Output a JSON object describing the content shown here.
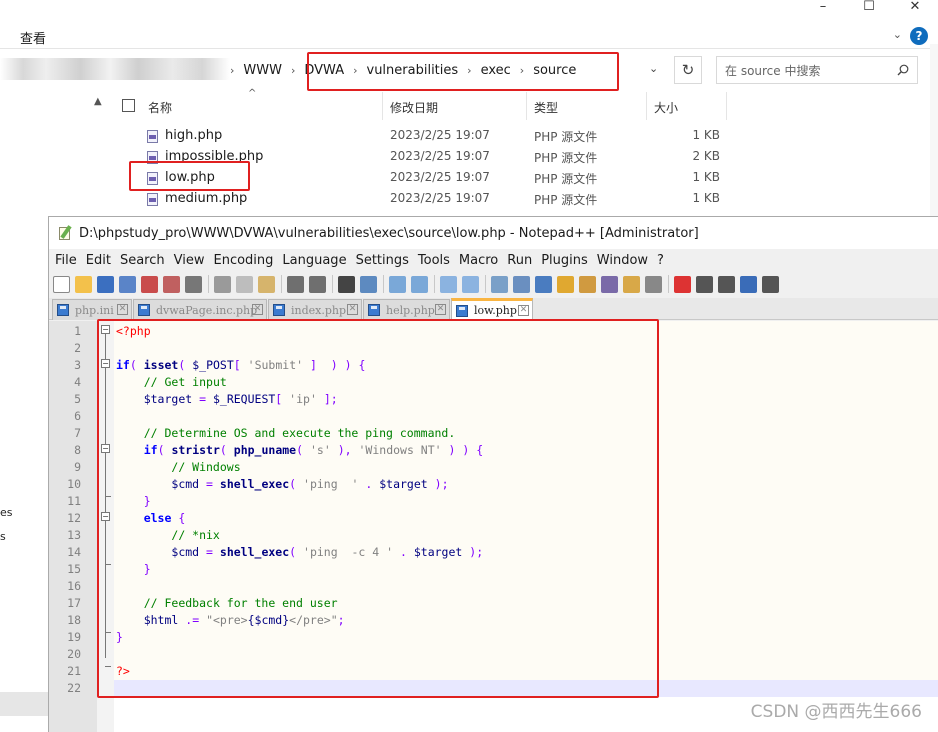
{
  "explorer": {
    "window_controls": [
      "–",
      "☐",
      "✕"
    ],
    "ribbon_label": "查看",
    "help_label": "?",
    "breadcrumb": [
      "WWW",
      "DVWA",
      "vulnerabilities",
      "exec",
      "source"
    ],
    "search_placeholder": "在 source 中搜索",
    "columns": {
      "name": "名称",
      "modified": "修改日期",
      "type": "类型",
      "size": "大小"
    },
    "files": [
      {
        "name": "high.php",
        "modified": "2023/2/25 19:07",
        "type": "PHP 源文件",
        "size": "1 KB"
      },
      {
        "name": "impossible.php",
        "modified": "2023/2/25 19:07",
        "type": "PHP 源文件",
        "size": "2 KB"
      },
      {
        "name": "low.php",
        "modified": "2023/2/25 19:07",
        "type": "PHP 源文件",
        "size": "1 KB"
      },
      {
        "name": "medium.php",
        "modified": "2023/2/25 19:07",
        "type": "PHP 源文件",
        "size": "1 KB"
      }
    ],
    "side_fragments": [
      "es",
      "s"
    ]
  },
  "npp": {
    "title": "D:\\phpstudy_pro\\WWW\\DVWA\\vulnerabilities\\exec\\source\\low.php - Notepad++ [Administrator]",
    "menu": [
      "File",
      "Edit",
      "Search",
      "View",
      "Encoding",
      "Language",
      "Settings",
      "Tools",
      "Macro",
      "Run",
      "Plugins",
      "Window",
      "?"
    ],
    "tabs": [
      {
        "label": "php.ini",
        "active": false
      },
      {
        "label": "dvwaPage.inc.php",
        "active": false
      },
      {
        "label": "index.php",
        "active": false
      },
      {
        "label": "help.php",
        "active": false
      },
      {
        "label": "low.php",
        "active": true
      }
    ],
    "line_numbers": [
      "1",
      "2",
      "3",
      "4",
      "5",
      "6",
      "7",
      "8",
      "9",
      "10",
      "11",
      "12",
      "13",
      "14",
      "15",
      "16",
      "17",
      "18",
      "19",
      "20",
      "21",
      "22"
    ]
  },
  "watermark": "CSDN @西西先生666",
  "colors": {
    "highlight": "#e02020",
    "tab_accent": "#fab542",
    "keyword": "#0000ff",
    "comment": "#008000",
    "string": "#808080",
    "php_tag": "#ff0000"
  }
}
